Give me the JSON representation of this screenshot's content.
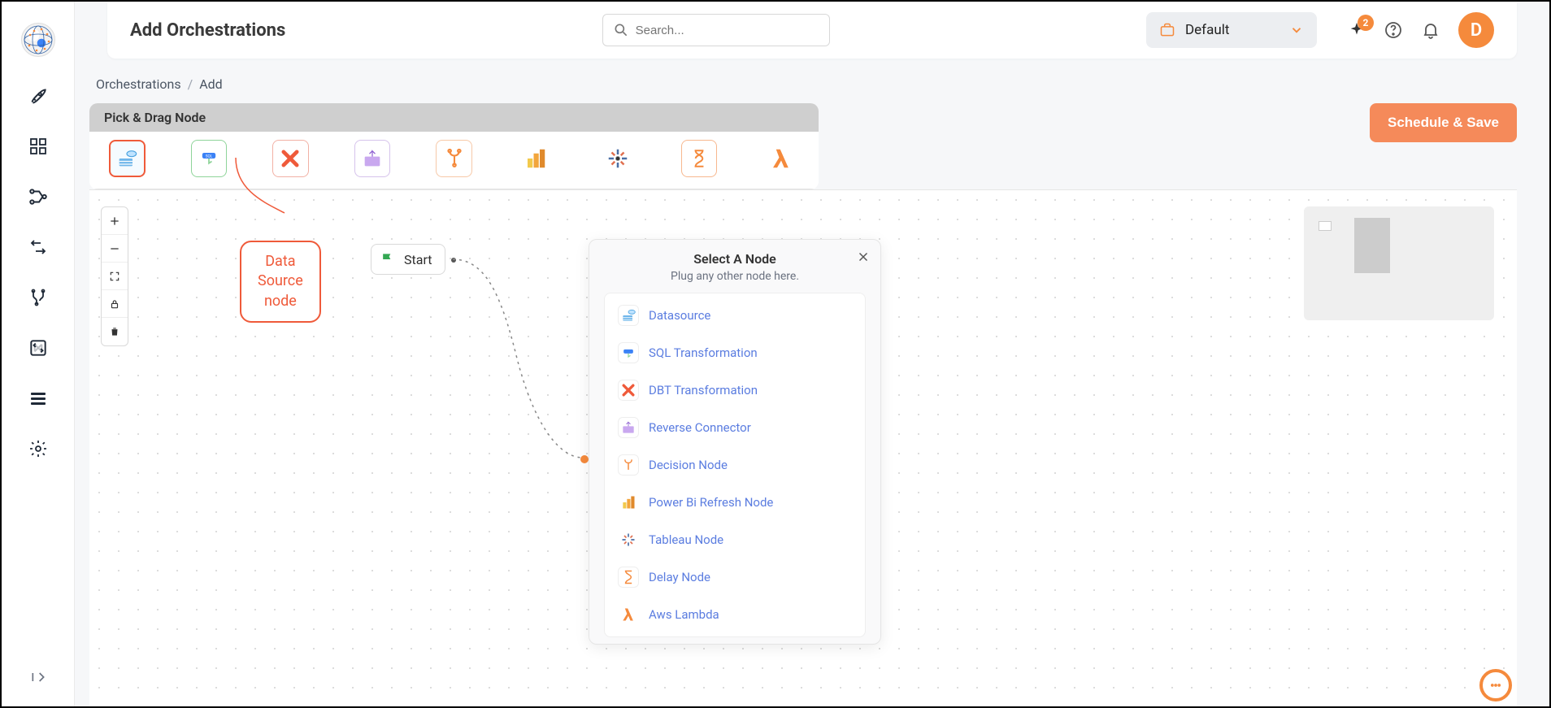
{
  "header": {
    "title": "Add Orchestrations",
    "search_placeholder": "Search...",
    "workspace": "Default",
    "notification_count": "2",
    "avatar_letter": "D"
  },
  "breadcrumb": {
    "root": "Orchestrations",
    "current": "Add"
  },
  "palette": {
    "header": "Pick & Drag Node"
  },
  "actions": {
    "schedule_save": "Schedule & Save"
  },
  "annotation": {
    "line1": "Data",
    "line2": "Source",
    "line3": "node"
  },
  "canvas": {
    "start_label": "Start"
  },
  "node_picker": {
    "title": "Select A Node",
    "subtitle": "Plug any other node here.",
    "items": [
      {
        "key": "datasource",
        "label": "Datasource"
      },
      {
        "key": "sql",
        "label": "SQL Transformation"
      },
      {
        "key": "dbt",
        "label": "DBT Transformation"
      },
      {
        "key": "reverse",
        "label": "Reverse Connector"
      },
      {
        "key": "decision",
        "label": "Decision Node"
      },
      {
        "key": "powerbi",
        "label": "Power Bi Refresh Node"
      },
      {
        "key": "tableau",
        "label": "Tableau Node"
      },
      {
        "key": "delay",
        "label": "Delay Node"
      },
      {
        "key": "lambda",
        "label": "Aws Lambda"
      }
    ]
  }
}
